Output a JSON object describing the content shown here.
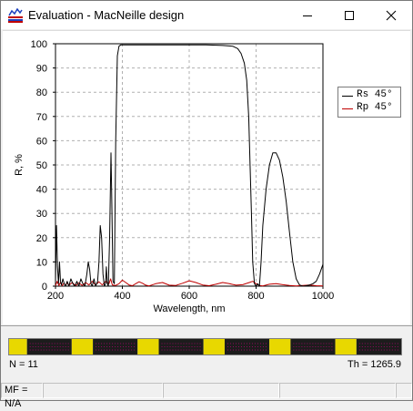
{
  "window": {
    "title": "Evaluation - MacNeille design",
    "controls": [
      "minimize",
      "maximize",
      "close"
    ]
  },
  "colors": {
    "rs": "#000000",
    "rp": "#c00000",
    "grid": "#b0b0b0",
    "layer_high": "#1c1c1c",
    "layer_low": "#e8d800",
    "layer_mark": "#c0007a"
  },
  "chart_data": {
    "type": "line",
    "xlabel": "Wavelength, nm",
    "ylabel": "R, %",
    "xlim": [
      200,
      1000
    ],
    "ylim": [
      0,
      100
    ],
    "xticks": [
      200,
      400,
      600,
      800,
      1000
    ],
    "yticks": [
      0,
      10,
      20,
      30,
      40,
      50,
      60,
      70,
      80,
      90,
      100
    ],
    "grid": true,
    "legend_position": "top-right",
    "series": [
      {
        "name": "Rs 45°",
        "x": [
          200,
          203,
          206,
          209,
          212,
          215,
          218,
          222,
          226,
          230,
          235,
          240,
          246,
          252,
          258,
          264,
          270,
          276,
          282,
          288,
          294,
          298,
          302,
          306,
          310,
          315,
          320,
          326,
          330,
          334,
          338,
          342,
          346,
          350,
          352,
          355,
          358,
          362,
          366,
          368,
          372,
          376,
          380,
          385,
          390,
          395,
          400,
          450,
          500,
          550,
          600,
          650,
          700,
          730,
          745,
          755,
          765,
          772,
          778,
          782,
          786,
          790,
          795,
          800,
          805,
          810,
          815,
          820,
          830,
          840,
          850,
          860,
          870,
          880,
          890,
          900,
          910,
          920,
          930,
          940,
          950,
          960,
          970,
          980,
          990,
          1000
        ],
        "y": [
          2,
          25,
          8,
          1,
          10,
          2,
          0.5,
          3,
          1,
          0,
          2,
          0,
          3,
          1,
          0,
          2,
          0,
          3,
          1,
          0,
          5,
          10,
          7,
          1,
          0,
          3,
          0,
          2,
          10,
          25,
          20,
          5,
          0,
          1,
          8,
          1,
          0,
          20,
          55,
          40,
          2,
          1,
          60,
          95,
          99,
          99.5,
          99.5,
          99.5,
          99.5,
          99.5,
          99.5,
          99.5,
          99.3,
          99,
          98,
          96,
          92,
          85,
          70,
          50,
          30,
          10,
          1,
          0,
          1,
          0,
          10,
          25,
          40,
          50,
          55,
          55,
          52,
          45,
          35,
          22,
          10,
          3,
          0.5,
          0,
          0.2,
          0.5,
          1,
          2,
          5,
          9
        ]
      },
      {
        "name": "Rp 45°",
        "x": [
          200,
          205,
          210,
          215,
          220,
          225,
          230,
          235,
          240,
          250,
          260,
          270,
          280,
          290,
          300,
          310,
          320,
          330,
          340,
          350,
          360,
          365,
          370,
          380,
          390,
          400,
          410,
          420,
          430,
          440,
          450,
          460,
          470,
          480,
          500,
          520,
          540,
          560,
          580,
          600,
          620,
          640,
          660,
          680,
          700,
          720,
          740,
          760,
          780,
          790,
          800,
          810,
          820,
          840,
          860,
          880,
          900,
          920,
          940,
          960,
          980,
          1000
        ],
        "y": [
          0.2,
          2,
          0.3,
          1.5,
          0.2,
          1.2,
          0.2,
          1.5,
          0.3,
          1.5,
          0.2,
          1.3,
          0.3,
          1.5,
          0.5,
          2,
          0.5,
          1.8,
          0.5,
          2,
          1,
          3,
          0.5,
          0.3,
          1,
          2.5,
          1.5,
          0.5,
          0.2,
          1,
          1.8,
          1.2,
          0.4,
          0.1,
          1,
          1.5,
          0.4,
          0.3,
          1.2,
          2.2,
          1.5,
          0.5,
          0.2,
          0.8,
          1.5,
          1,
          0.4,
          0.6,
          1.5,
          2,
          1,
          0.3,
          0.1,
          0.8,
          1,
          0.6,
          0.3,
          0.1,
          0.3,
          0.5,
          0.2,
          0.1
        ]
      }
    ]
  },
  "design": {
    "layer_pattern": [
      "H",
      "L",
      "H",
      "L",
      "H",
      "L",
      "H",
      "L",
      "H",
      "L",
      "H"
    ],
    "n_label": "N = 11",
    "th_label": "Th = 1265.9"
  },
  "status": {
    "mf": "MF = N/A"
  }
}
